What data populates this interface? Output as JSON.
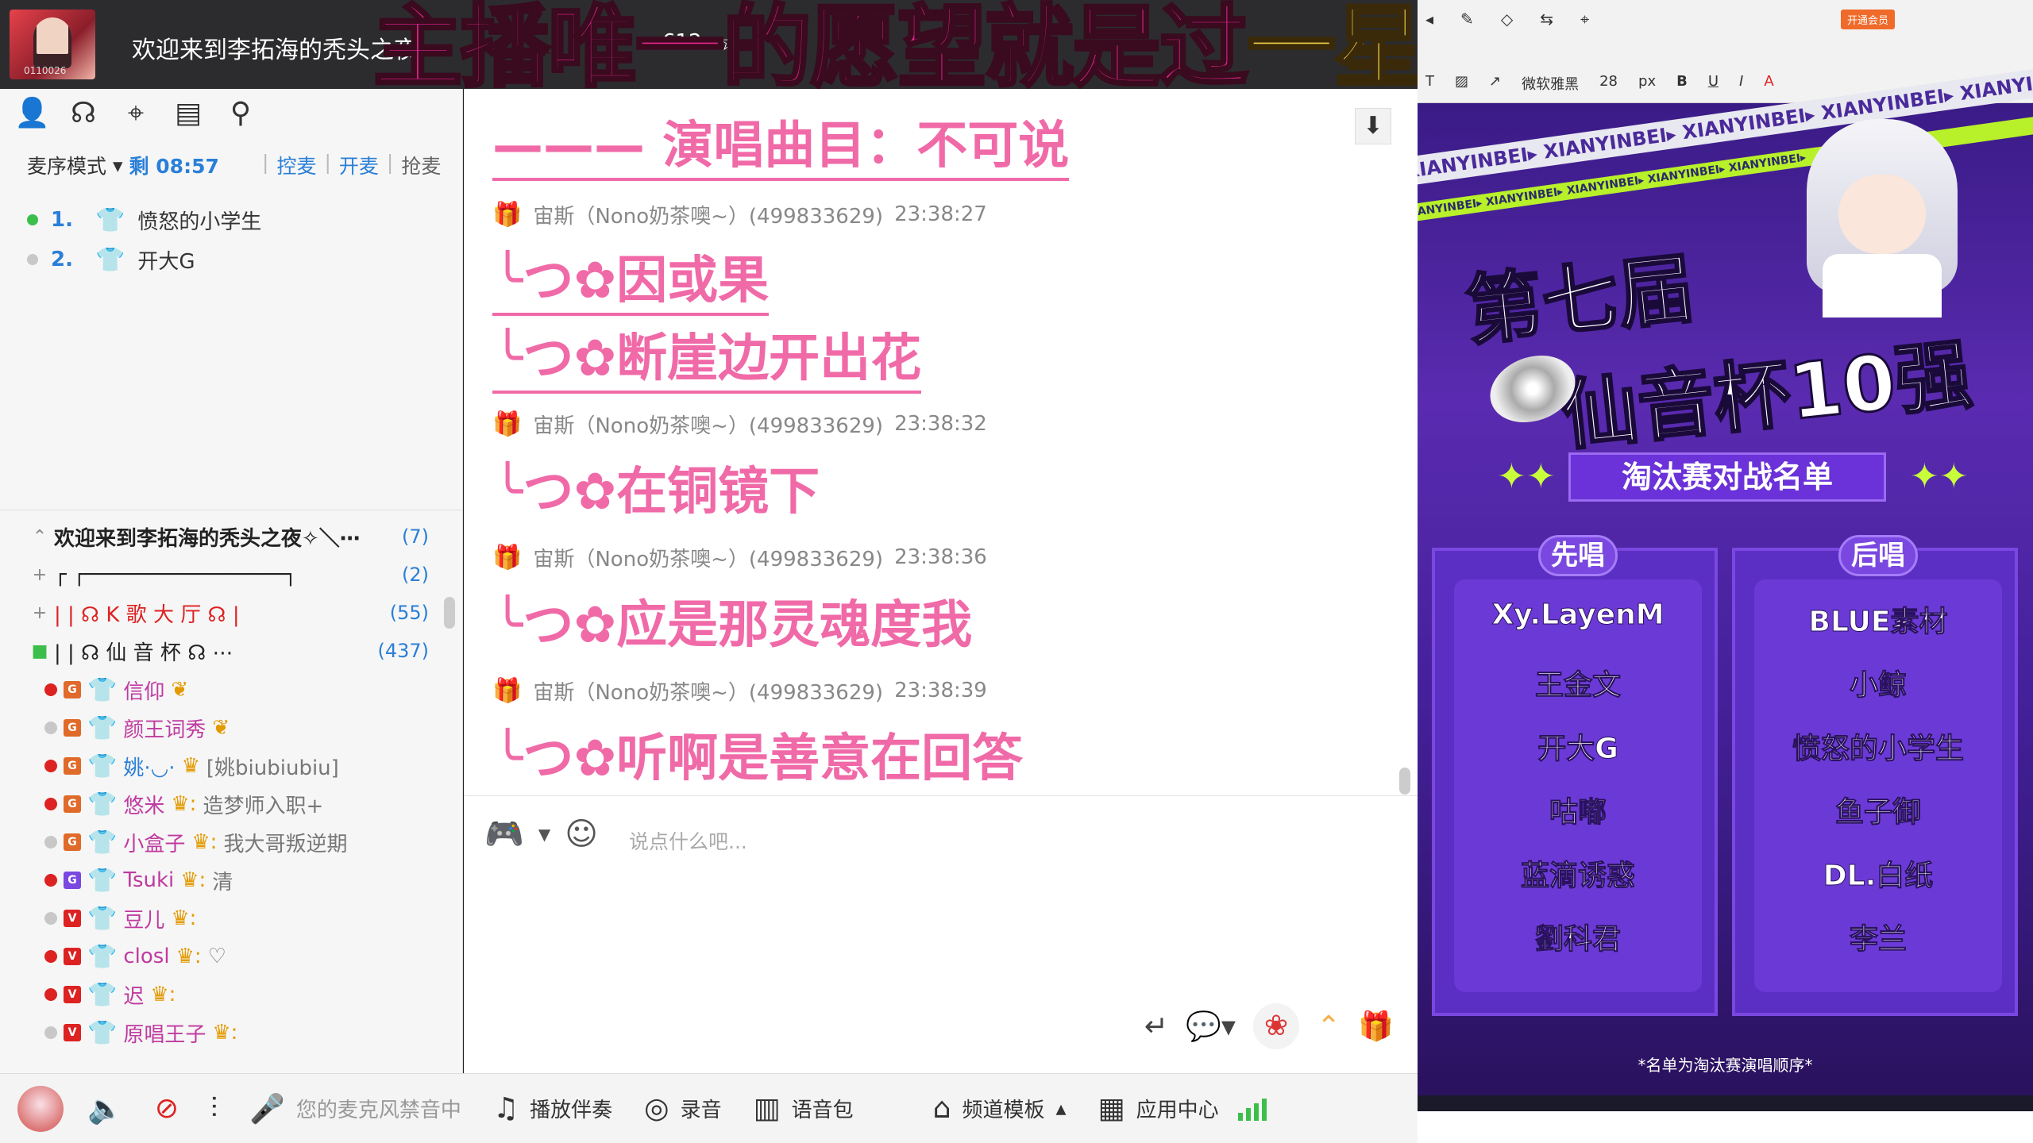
{
  "topbar": {
    "room_title": "欢迎来到李拓海的秃头之夜",
    "room_id_fragment": "612",
    "avatar_caption": "0110026"
  },
  "banner": {
    "part1": "主播唯一的愿望就是过",
    "part2": "一星~"
  },
  "toolbar_icons": [
    "person-icon",
    "headset-icon",
    "location-icon",
    "board-icon",
    "search-icon"
  ],
  "mic": {
    "mode_label": "麦序模式",
    "remaining": "剩 08:57",
    "actions": [
      "控麦",
      "开麦",
      "抢麦"
    ],
    "queue": [
      {
        "num": "1.",
        "name": "愤怒的小学生",
        "status_color": "#3cbf4a"
      },
      {
        "num": "2.",
        "name": "开大G",
        "status_color": "#c8c8c8"
      }
    ]
  },
  "channels": [
    {
      "name": "欢迎来到李拓海的秃头之夜✧＼⋯",
      "count": "(7)",
      "bold": true
    },
    {
      "name": "┌ ┌────────────────┐",
      "count": "(2)"
    },
    {
      "name": "| |   ☊  K 歌 大 厅 ☊        |",
      "count": "(55)"
    },
    {
      "name": "| |   ☊   仙 音 杯   ☊      ⋯",
      "count": "(437)"
    }
  ],
  "members": [
    {
      "nick": "信仰",
      "status": "",
      "online": true,
      "lvl": "G",
      "lvl_color": "#e06a2a"
    },
    {
      "nick": "颜王词秀",
      "status": "",
      "online": false,
      "lvl": "G",
      "lvl_color": "#e06a2a"
    },
    {
      "nick": "姚·◡·",
      "status": "[姚biubiubiu]",
      "online": true,
      "lvl": "G",
      "lvl_color": "#e06a2a"
    },
    {
      "nick": "悠米",
      "status": "造梦师入职+",
      "online": true,
      "lvl": "G",
      "lvl_color": "#e06a2a"
    },
    {
      "nick": "小盒子",
      "status": "我大哥叛逆期",
      "online": false,
      "lvl": "G",
      "lvl_color": "#e06a2a"
    },
    {
      "nick": "Tsuki",
      "status": "清",
      "online": true,
      "lvl": "G",
      "lvl_color": "#7a48e0"
    },
    {
      "nick": "豆儿",
      "status": "",
      "online": false,
      "lvl": "V",
      "lvl_color": "#d22"
    },
    {
      "nick": "closl",
      "status": "♡",
      "online": true,
      "lvl": "V",
      "lvl_color": "#d22"
    },
    {
      "nick": "迟",
      "status": "",
      "online": true,
      "lvl": "V",
      "lvl_color": "#d22"
    },
    {
      "nick": "原唱王子",
      "status": "",
      "online": false,
      "lvl": "V",
      "lvl_color": "#d22"
    }
  ],
  "chat": {
    "song_title": "——— 演唱曲目：不可说",
    "messages": [
      {
        "author": "宙斯（Nono奶茶噢~）(499833629)",
        "time": "23:38:27",
        "lines": [
          "╰つ✿因或果",
          "╰つ✿断崖边开出花"
        ]
      },
      {
        "author": "宙斯（Nono奶茶噢~）(499833629)",
        "time": "23:38:32",
        "lines": [
          "╰つ✿在铜镜下"
        ]
      },
      {
        "author": "宙斯（Nono奶茶噢~）(499833629)",
        "time": "23:38:36",
        "lines": [
          "╰つ✿应是那灵魂度我"
        ]
      },
      {
        "author": "宙斯（Nono奶茶噢~）(499833629)",
        "time": "23:38:39",
        "lines": [
          "╰つ✿听啊是善意在回答"
        ]
      }
    ],
    "input_placeholder": "说点什么吧..."
  },
  "bottombar": {
    "mic_muted_text": "您的麦克风禁音中",
    "play_accomp": "播放伴奏",
    "record": "录音",
    "voice_pack": "语音包",
    "channel_template": "频道模板",
    "app_center": "应用中心"
  },
  "editor": {
    "vip_label": "开通会员",
    "font_name": "微软雅黑",
    "font_size": "28",
    "font_unit": "px"
  },
  "poster": {
    "strip_text": "XIANYINBEI▸ XIANYINBEI▸ XIANYINBEI▸ XIANYINBEI▸ XIANYINBEI▸",
    "title_line1": "第七届",
    "title_line2": "仙音杯10强",
    "subtitle": "淘汰赛对战名单",
    "left_head": "先唱",
    "right_head": "后唱",
    "left_names": [
      "Xy.LayenM",
      "王金文",
      "开大G",
      "咕嘟",
      "蓝滴诱惑",
      "劉科君"
    ],
    "right_names": [
      "BLUE素材",
      "小鲸",
      "愤怒的小学生",
      "鱼子御",
      "DL.白纸",
      "李兰"
    ],
    "note": "*名单为淘汰赛演唱顺序*"
  },
  "colors": {
    "accent_pink": "#f06aa8",
    "link_blue": "#2a7fd8",
    "poster_purple": "#5c2fc4"
  }
}
